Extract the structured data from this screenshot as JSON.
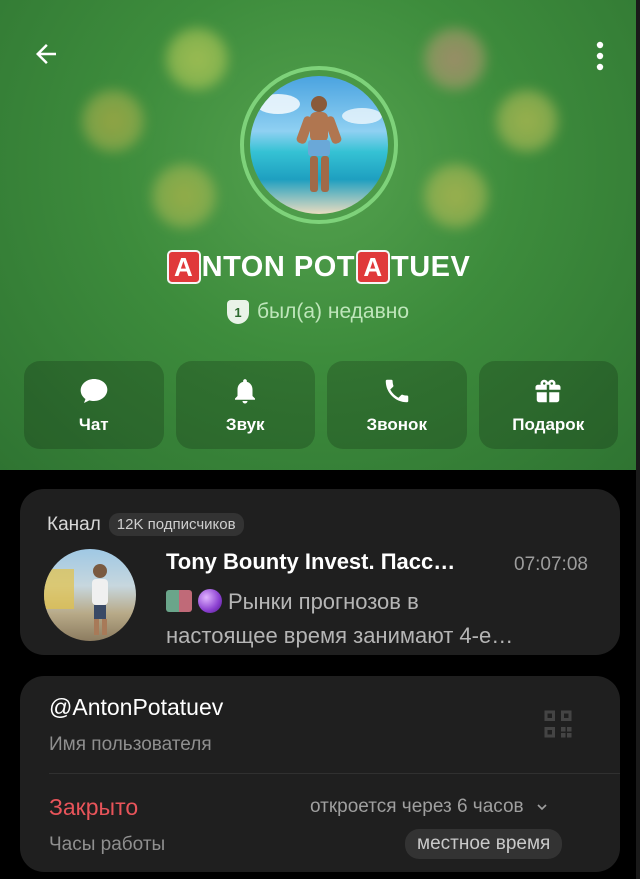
{
  "profile": {
    "name_parts": [
      "NTON POT",
      "TUEV"
    ],
    "badge_letter": "A",
    "status": "был(а) недавно",
    "status_badge": "1"
  },
  "actions": [
    {
      "label": "Чат",
      "icon": "chat-bubble-icon"
    },
    {
      "label": "Звук",
      "icon": "bell-icon"
    },
    {
      "label": "Звонок",
      "icon": "phone-icon"
    },
    {
      "label": "Подарок",
      "icon": "gift-icon"
    }
  ],
  "channel": {
    "section_label": "Канал",
    "subscribers": "12K подписчиков",
    "title": "Tony Bounty Invest. Пасс…",
    "time": "07:07:08",
    "message_line1": "Рынки прогнозов в",
    "message_line2": "настоящее время занимают 4-е…"
  },
  "info": {
    "username": "@AntonPotatuev",
    "username_label": "Имя пользователя",
    "hours_status": "Закрыто",
    "hours_label": "Часы работы",
    "opens_in": "откроется через 6 часов",
    "local_time": "местное время"
  },
  "colors": {
    "header_green": "#3d8c3c",
    "accent_ring": "#7ed27a",
    "closed_red": "#e8545a",
    "card_bg": "#1f1f1f"
  }
}
